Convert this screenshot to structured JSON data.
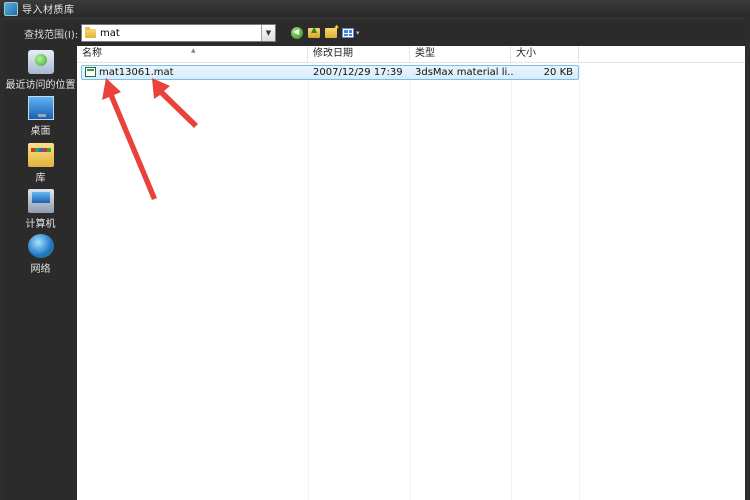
{
  "window": {
    "title": "导入材质库"
  },
  "toolbar": {
    "look_in_label": "查找范围(I):",
    "look_in_value": "mat",
    "view_dropdown_glyph": "▾",
    "combo_drop_glyph": "▼"
  },
  "places": [
    {
      "label": "最近访问的位置",
      "icon": "recent-places-icon"
    },
    {
      "label": "桌面",
      "icon": "desktop-icon"
    },
    {
      "label": "库",
      "icon": "libraries-icon"
    },
    {
      "label": "计算机",
      "icon": "computer-icon"
    },
    {
      "label": "网络",
      "icon": "network-icon"
    }
  ],
  "columns": {
    "name": "名称",
    "modified": "修改日期",
    "type": "类型",
    "size": "大小"
  },
  "files": [
    {
      "name": "mat13061.mat",
      "modified": "2007/12/29 17:39",
      "type": "3dsMax material li...",
      "size": "20 KB",
      "selected": true
    }
  ],
  "colors": {
    "selection_fill": "#d6ecfb",
    "selection_border": "#7fbde9",
    "annotation_arrow": "#e8423a",
    "chrome_dark": "#2b2b2b"
  }
}
